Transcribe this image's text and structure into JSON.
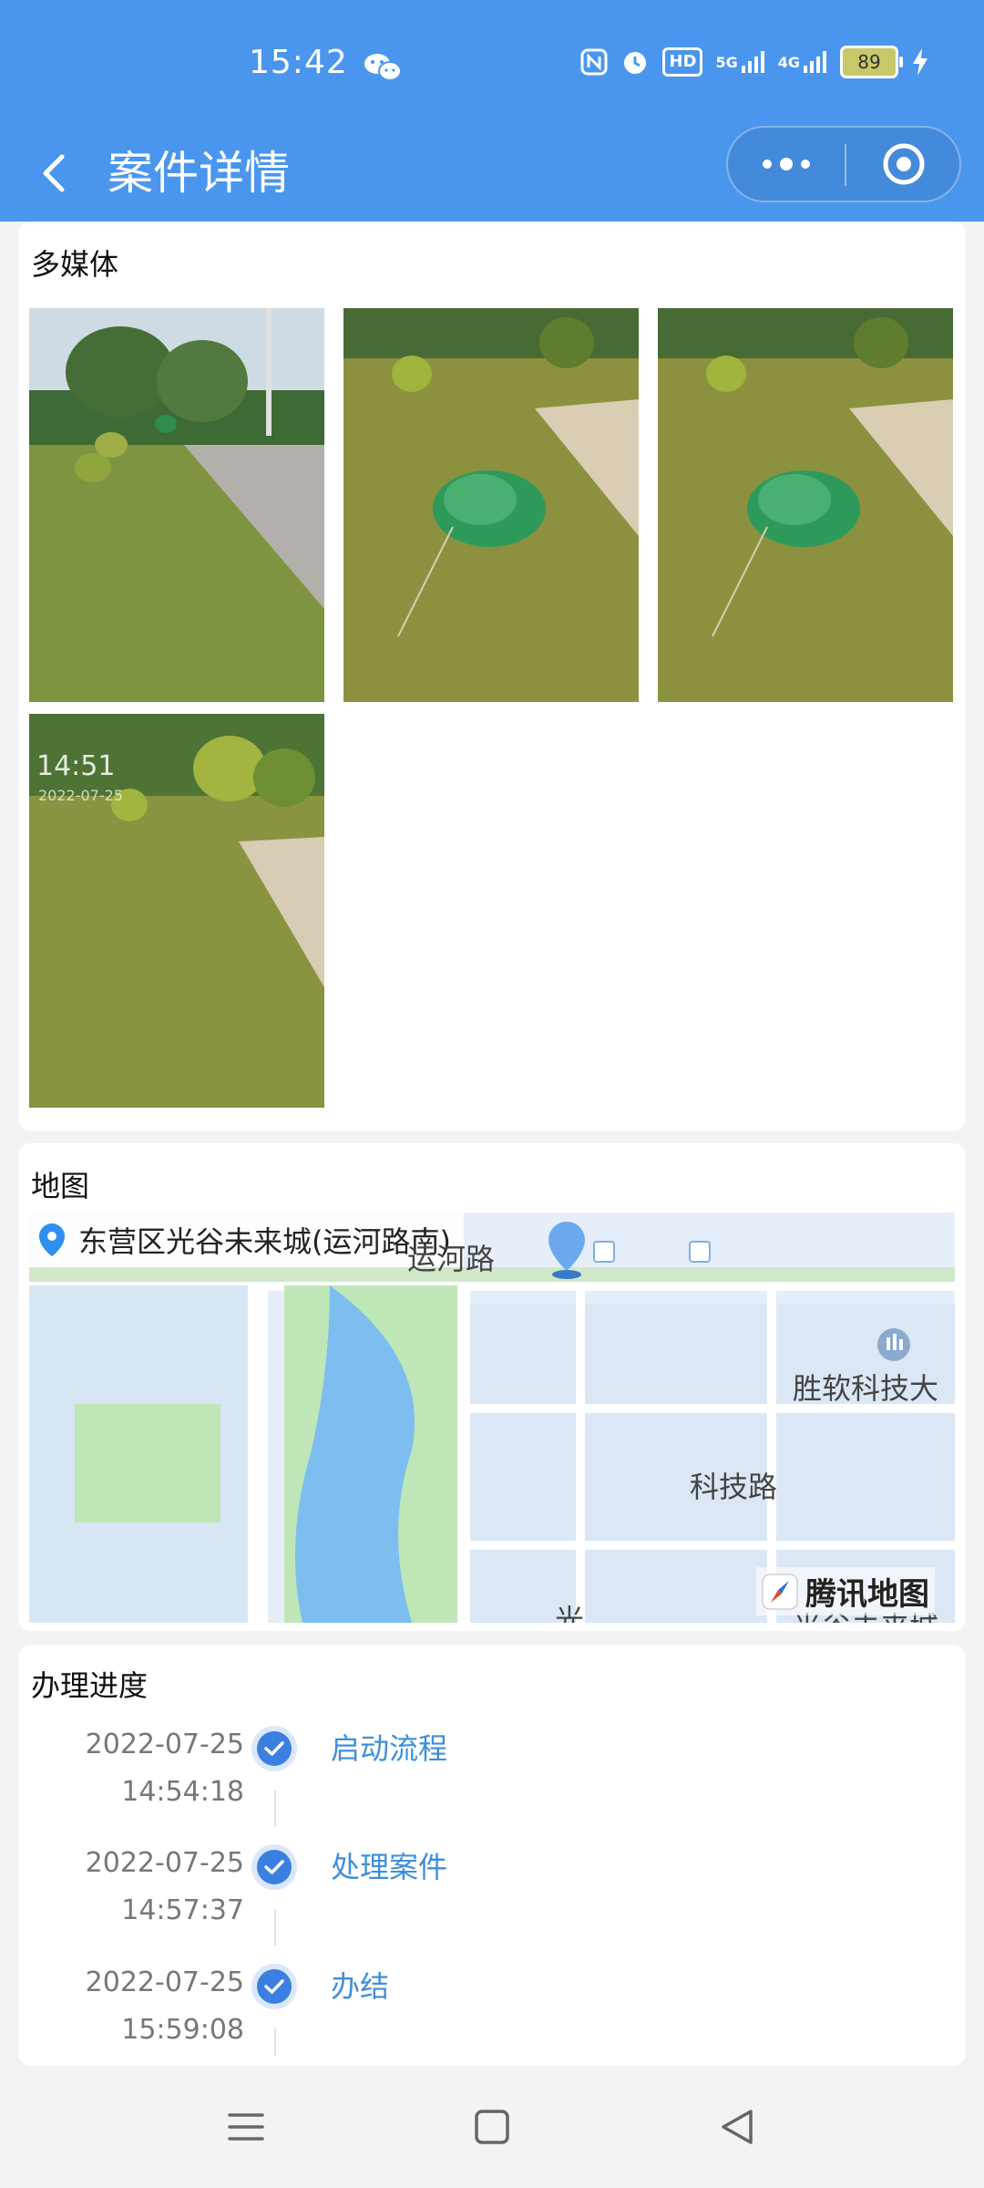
{
  "status_bar": {
    "time": "15:42",
    "battery": "89",
    "network_labels": [
      "5G",
      "4G"
    ],
    "hd_label": "HD"
  },
  "header": {
    "title": "案件详情"
  },
  "media": {
    "title": "多媒体",
    "photos": [
      {
        "name": "photo-1"
      },
      {
        "name": "photo-2"
      },
      {
        "name": "photo-3"
      },
      {
        "name": "photo-4",
        "overlay_time": "14:51",
        "overlay_date": "2022-07-25"
      }
    ]
  },
  "map": {
    "title": "地图",
    "address": "东营区光谷未来城(运河路南)",
    "labels": {
      "road_top": "运河路",
      "building": "胜软科技大",
      "road_tech": "科技路",
      "bottom_left": "光",
      "bottom_right": "光谷未来城"
    },
    "logo_text": "腾讯地图"
  },
  "progress": {
    "title": "办理进度",
    "steps": [
      {
        "date": "2022-07-25",
        "time": "14:54:18",
        "label": "启动流程"
      },
      {
        "date": "2022-07-25",
        "time": "14:57:37",
        "label": "处理案件"
      },
      {
        "date": "2022-07-25",
        "time": "15:59:08",
        "label": "办结"
      }
    ]
  },
  "colors": {
    "header_bg": "#4a96ee",
    "step_blue": "#3e8edc",
    "check_blue": "#3b7fe0"
  }
}
